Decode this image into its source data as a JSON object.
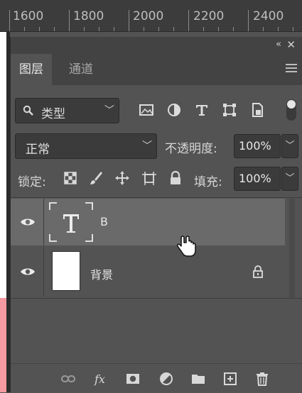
{
  "ruler": {
    "ticks": [
      "1600",
      "1800",
      "2000",
      "2200",
      "2400"
    ]
  },
  "panel": {
    "tabs": [
      {
        "label": "图层",
        "active": true
      },
      {
        "label": "通道",
        "active": false
      }
    ],
    "filter": {
      "kind_label": "类型"
    },
    "blend_mode": "正常",
    "opacity_label": "不透明度:",
    "opacity_value": "100%",
    "lock_label": "锁定:",
    "fill_label": "填充:",
    "fill_value": "100%",
    "layers": [
      {
        "name": "B",
        "type": "text",
        "selected": true,
        "visible": true,
        "locked": false
      },
      {
        "name": "背景",
        "type": "pixel",
        "selected": false,
        "visible": true,
        "locked": true
      }
    ]
  },
  "icons": {
    "filter_icons": [
      "image-filter-icon",
      "adjustment-filter-icon",
      "type-filter-icon",
      "shape-filter-icon",
      "smart-object-filter-icon"
    ],
    "lock_icons": [
      "lock-transparent-icon",
      "lock-image-icon",
      "lock-position-icon",
      "lock-artboard-icon",
      "lock-all-icon"
    ],
    "bottom_icons": [
      "link-layers-icon",
      "fx-icon",
      "add-mask-icon",
      "adjustment-layer-icon",
      "new-group-icon",
      "new-layer-icon",
      "trash-icon"
    ]
  },
  "colors": {
    "panel_bg": "#535353",
    "selected_layer": "#6a6a6a",
    "canvas_pink": "#f59aa0"
  }
}
